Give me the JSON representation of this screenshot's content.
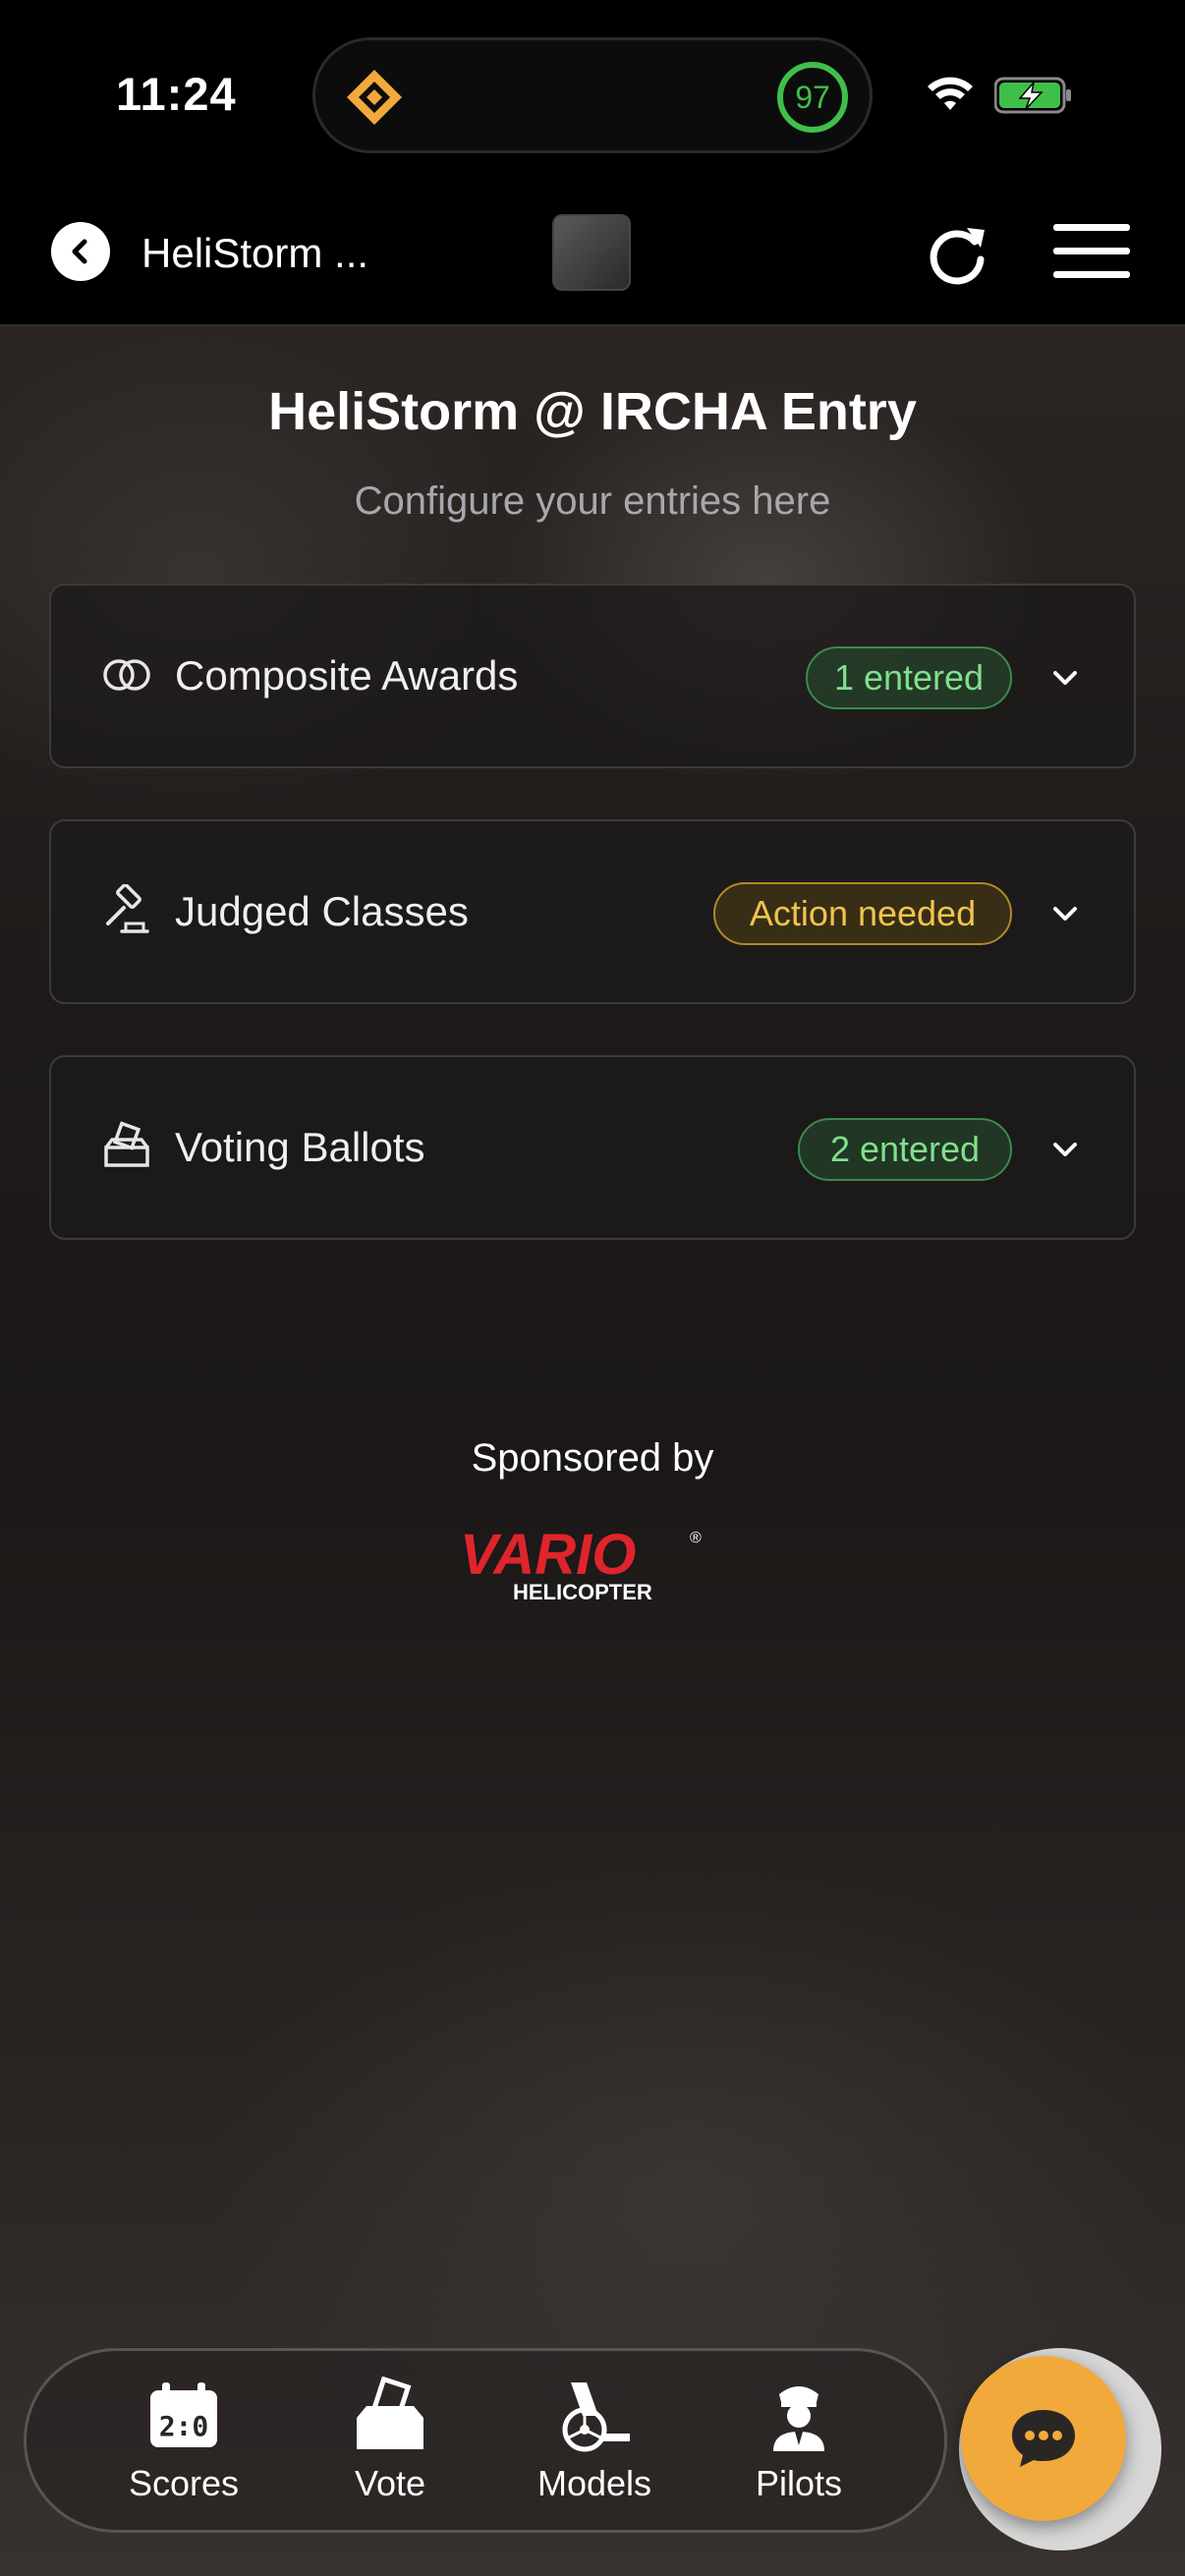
{
  "status_bar": {
    "time": "11:24",
    "ring_value": "97"
  },
  "header": {
    "title": "HeliStorm ...",
    "logo_text": "HeliStorm"
  },
  "page": {
    "title": "HeliStorm @ IRCHA Entry",
    "subtitle": "Configure your entries here"
  },
  "sections": [
    {
      "label": "Composite Awards",
      "badge": "1 entered",
      "badge_status": "green"
    },
    {
      "label": "Judged Classes",
      "badge": "Action needed",
      "badge_status": "yellow"
    },
    {
      "label": "Voting Ballots",
      "badge": "2 entered",
      "badge_status": "green"
    }
  ],
  "sponsor": {
    "label": "Sponsored by",
    "logo_text": "VARIO HELICOPTER"
  },
  "tabs": [
    {
      "label": "Scores",
      "icon": "calendar-score-icon"
    },
    {
      "label": "Vote",
      "icon": "ballot-box-icon"
    },
    {
      "label": "Models",
      "icon": "helicopter-model-icon"
    },
    {
      "label": "Pilots",
      "icon": "pilot-icon"
    }
  ],
  "colors": {
    "accent_orange": "#f2a93b",
    "badge_green": "#7fe08d",
    "badge_yellow": "#f1c44d"
  }
}
